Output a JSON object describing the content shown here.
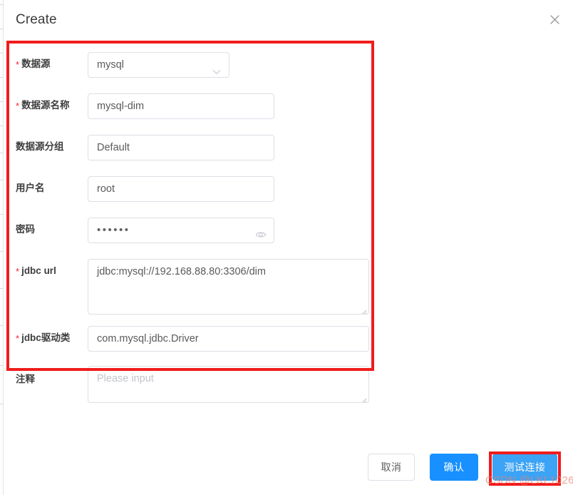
{
  "dialog": {
    "title": "Create",
    "close_icon": "close-icon"
  },
  "form": {
    "fields": [
      {
        "key": "datasource",
        "label": "数据源",
        "required": true,
        "type": "select",
        "value": "mysql",
        "icon": "chevron-down-icon"
      },
      {
        "key": "datasource_name",
        "label": "数据源名称",
        "required": true,
        "type": "input",
        "value": "mysql-dim"
      },
      {
        "key": "datasource_group",
        "label": "数据源分组",
        "required": false,
        "type": "input",
        "value": "Default"
      },
      {
        "key": "username",
        "label": "用户名",
        "required": false,
        "type": "input",
        "value": "root"
      },
      {
        "key": "password",
        "label": "密码",
        "required": false,
        "type": "password",
        "value": "••••••",
        "icon": "eye-icon"
      },
      {
        "key": "jdbc_url",
        "label": "jdbc url",
        "required": true,
        "type": "textarea",
        "value": "jdbc:mysql://192.168.88.80:3306/dim"
      },
      {
        "key": "jdbc_driver",
        "label": "jdbc驱动类",
        "required": true,
        "type": "input",
        "value": "com.mysql.jdbc.Driver"
      },
      {
        "key": "comment",
        "label": "注释",
        "required": false,
        "type": "textarea",
        "value": "",
        "placeholder": "Please input"
      }
    ]
  },
  "footer": {
    "cancel_label": "取消",
    "confirm_label": "确认",
    "test_label": "测试连接"
  },
  "annotations": {
    "form_box_color": "#f01c1c",
    "button_box_color": "#f01c1c"
  },
  "watermark": {
    "text": "CSDN @LKL1026"
  }
}
